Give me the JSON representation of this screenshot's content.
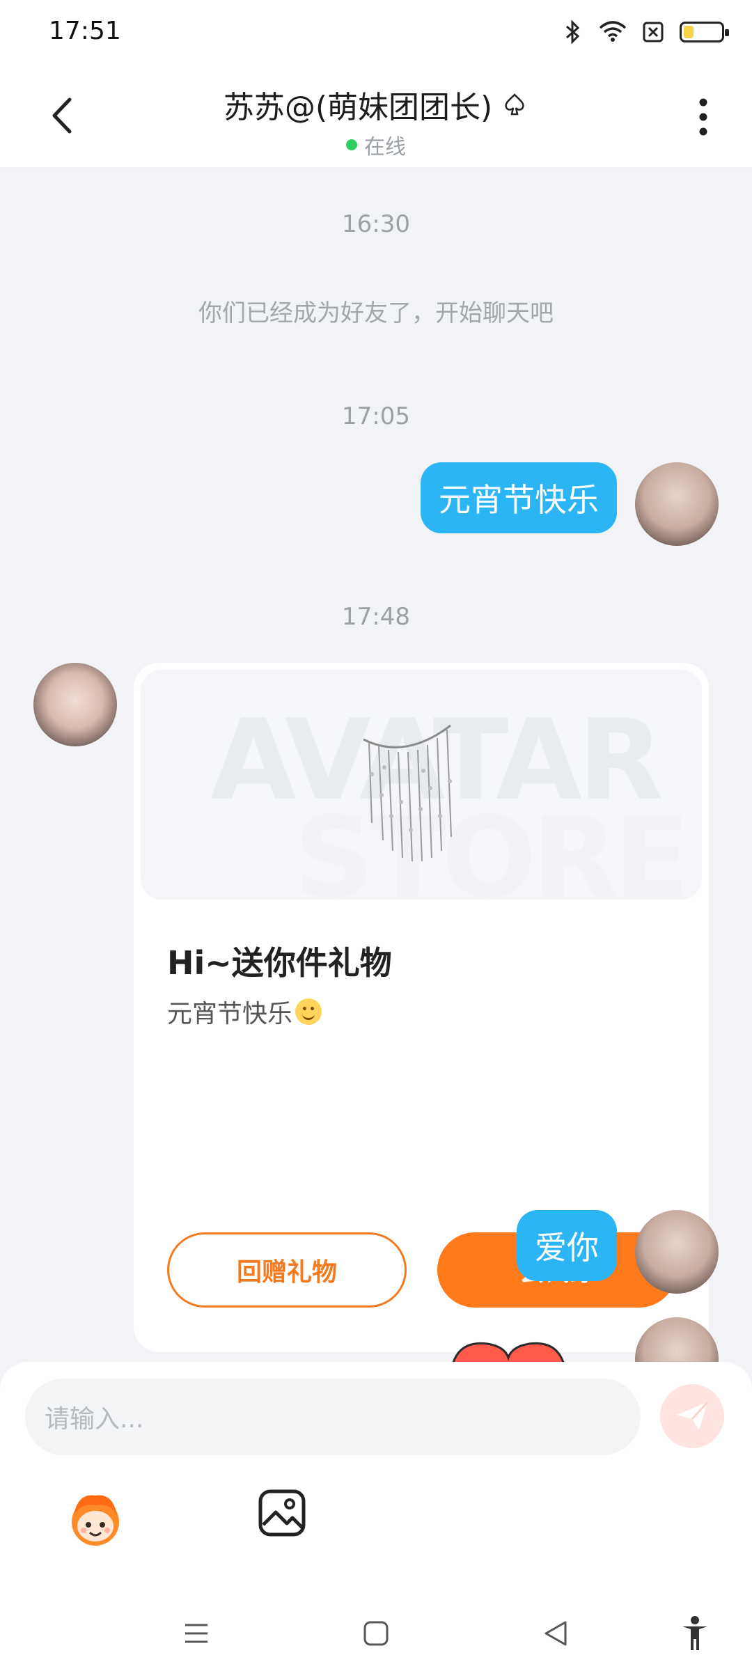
{
  "status_bar": {
    "time": "17:51",
    "icons": [
      "bluetooth-icon",
      "wifi-icon",
      "sim-off-icon",
      "battery-icon"
    ]
  },
  "header": {
    "title": "苏苏@(萌妹团团长)",
    "status": "在线",
    "title_icon": "spade-icon"
  },
  "messages": {
    "t1": "16:30",
    "system": "你们已经成为好友了，开始聊天吧",
    "t2": "17:05",
    "msg1": "元宵节快乐",
    "t3": "17:48",
    "gift_card": {
      "title": "Hi~送你件礼物",
      "subtitle": "元宵节快乐",
      "watermark_line1": "AVATAR",
      "watermark_line2": "STORE",
      "btn_return": "回赠礼物",
      "btn_try": "去试穿"
    },
    "msg2": "爱你"
  },
  "composer": {
    "placeholder": "请输入..."
  },
  "colors": {
    "bubble": "#2bb5f4",
    "accent_orange": "#ff7a1b",
    "online": "#2ccf5c"
  },
  "nav": {
    "items": [
      "menu-icon",
      "home-icon",
      "back-icon",
      "accessibility-icon"
    ]
  }
}
